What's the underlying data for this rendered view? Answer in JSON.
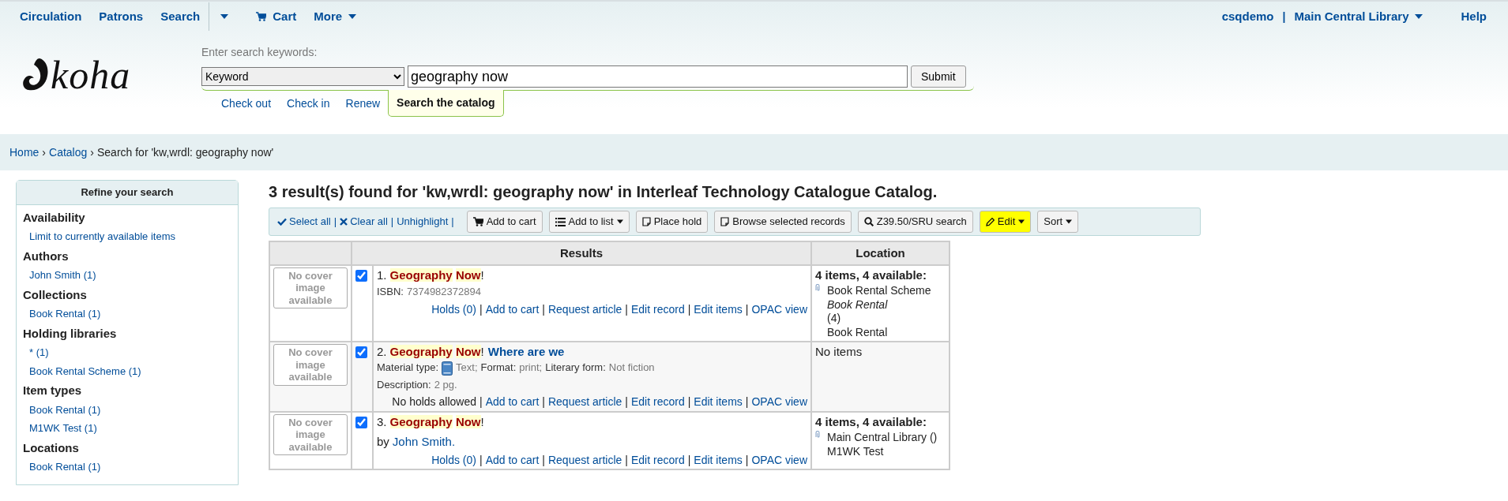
{
  "top_nav": {
    "items": [
      {
        "kind": "link",
        "label": "Circulation"
      },
      {
        "kind": "link",
        "label": "Patrons"
      },
      {
        "kind": "split",
        "label": "Search"
      },
      {
        "kind": "caret"
      },
      {
        "kind": "cart",
        "label": "Cart"
      },
      {
        "kind": "dropdown",
        "label": "More"
      }
    ],
    "user": "csqdemo",
    "separator": "|",
    "library": "Main Central Library",
    "help": "Help"
  },
  "logo": {
    "text": "koha"
  },
  "search": {
    "prompt": "Enter search keywords:",
    "index": "Keyword",
    "query": "geography now",
    "submit": "Submit",
    "tabs": [
      {
        "label": "Check out",
        "selected": false
      },
      {
        "label": "Check in",
        "selected": false
      },
      {
        "label": "Renew",
        "selected": false
      },
      {
        "label": "Search the catalog",
        "selected": true
      }
    ]
  },
  "breadcrumb": {
    "separator": "›",
    "links": [
      "Home",
      "Catalog"
    ],
    "current": "Search for 'kw,wrdl: geography now'"
  },
  "facets": {
    "title": "Refine your search",
    "groups": [
      {
        "heading": "Availability",
        "items": [
          "Limit to currently available items"
        ]
      },
      {
        "heading": "Authors",
        "items": [
          "John Smith (1)"
        ]
      },
      {
        "heading": "Collections",
        "items": [
          "Book Rental (1)"
        ]
      },
      {
        "heading": "Holding libraries",
        "items": [
          "* (1)",
          "Book Rental Scheme (1)"
        ]
      },
      {
        "heading": "Item types",
        "items": [
          "Book Rental (1)",
          "M1WK Test (1)"
        ]
      },
      {
        "heading": "Locations",
        "items": [
          "Book Rental (1)"
        ]
      }
    ]
  },
  "results_heading": "3 result(s) found for 'kw,wrdl: geography now' in Interleaf Technology Catalogue Catalog.",
  "toolbar": {
    "separator": "|",
    "links": [
      {
        "kind": "check",
        "label": "Select all"
      },
      {
        "kind": "cross",
        "label": "Clear all"
      },
      {
        "kind": "plain",
        "label": "Unhighlight"
      }
    ],
    "buttons": [
      {
        "kind": "cart",
        "label": "Add to cart",
        "dropdown": false,
        "highlighted": false
      },
      {
        "kind": "list",
        "label": "Add to list",
        "dropdown": true,
        "highlighted": false
      },
      {
        "kind": "note",
        "label": "Place hold",
        "dropdown": false,
        "highlighted": false
      },
      {
        "kind": "note",
        "label": "Browse selected records",
        "dropdown": false,
        "highlighted": false
      },
      {
        "kind": "search",
        "label": "Z39.50/SRU search",
        "dropdown": false,
        "highlighted": false
      },
      {
        "kind": "pencil",
        "label": "Edit",
        "dropdown": true,
        "highlighted": true
      },
      {
        "kind": "plain",
        "label": "Sort",
        "dropdown": true,
        "highlighted": false
      }
    ]
  },
  "table": {
    "columns": [
      "Results",
      "Location"
    ],
    "separator": "|",
    "rows": [
      {
        "cover": "No cover image available",
        "checked": true,
        "number": "1.",
        "title_terms": [
          "Geography",
          "Now"
        ],
        "title_rest": "!",
        "details": [
          {
            "kind": "labeled",
            "label": "ISBN:",
            "value": "7374982372894"
          }
        ],
        "actions": [
          {
            "label": "Holds (0)",
            "link": true
          },
          {
            "label": "Add to cart",
            "link": true
          },
          {
            "label": "Request article",
            "link": true
          },
          {
            "label": "Edit record",
            "link": true
          },
          {
            "label": "Edit items",
            "link": true
          },
          {
            "label": "OPAC view",
            "link": true
          }
        ],
        "location": {
          "kind": "items",
          "summary": "4 items, 4 available:",
          "lines": [
            {
              "text": "Book Rental Scheme",
              "italic": false
            },
            {
              "text": "Book Rental",
              "italic": true
            },
            {
              "text": "(4)",
              "italic": false
            },
            {
              "text": "Book Rental",
              "italic": false
            }
          ]
        }
      },
      {
        "cover": "No cover image available",
        "checked": true,
        "number": "2.",
        "title_terms": [
          "Geography",
          "Now"
        ],
        "title_rest": "!",
        "subtitle": "Where are we",
        "details": [
          {
            "kind": "fields",
            "pieces": [
              {
                "label": "Material type:",
                "value": "Text",
                "suffix": ";",
                "icon": true
              },
              {
                "label": "Format:",
                "value": "print",
                "suffix": ";",
                "icon": false
              },
              {
                "label": "Literary form:",
                "value": "Not fiction",
                "icon": false
              }
            ]
          },
          {
            "kind": "labeled",
            "label": "Description:",
            "value": "2 pg."
          }
        ],
        "actions": [
          {
            "label": "No holds allowed",
            "link": false
          },
          {
            "label": "Add to cart",
            "link": true
          },
          {
            "label": "Request article",
            "link": true
          },
          {
            "label": "Edit record",
            "link": true
          },
          {
            "label": "Edit items",
            "link": true
          },
          {
            "label": "OPAC view",
            "link": true
          }
        ],
        "location": {
          "kind": "none",
          "text": "No items"
        }
      },
      {
        "cover": "No cover image available",
        "checked": true,
        "number": "3.",
        "title_terms": [
          "Geography",
          "Now"
        ],
        "title_rest": "!",
        "details": [
          {
            "kind": "author",
            "prefix": "by",
            "value": "John Smith",
            "suffix": "."
          }
        ],
        "actions": [
          {
            "label": "Holds (0)",
            "link": true
          },
          {
            "label": "Add to cart",
            "link": true
          },
          {
            "label": "Request article",
            "link": true
          },
          {
            "label": "Edit record",
            "link": true
          },
          {
            "label": "Edit items",
            "link": true
          },
          {
            "label": "OPAC view",
            "link": true
          }
        ],
        "location": {
          "kind": "items",
          "summary": "4 items, 4 available:",
          "lines": [
            {
              "text": "Main Central Library ()",
              "italic": false
            },
            {
              "text": "M1WK Test",
              "italic": false
            }
          ]
        }
      }
    ]
  }
}
